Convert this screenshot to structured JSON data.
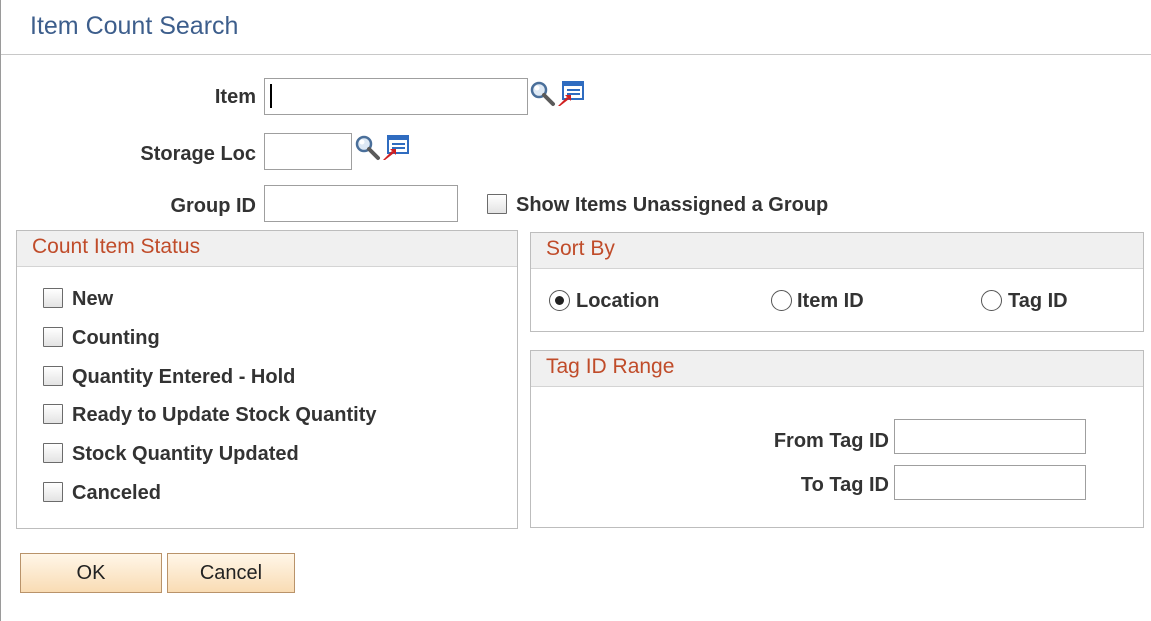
{
  "page": {
    "title": "Item Count Search"
  },
  "fields": {
    "item": {
      "label": "Item",
      "value": ""
    },
    "storage_loc": {
      "label": "Storage Loc",
      "value": ""
    },
    "group_id": {
      "label": "Group ID",
      "value": ""
    },
    "show_unassigned": {
      "label": "Show Items Unassigned a Group",
      "checked": false
    }
  },
  "icons": {
    "lookup": "magnifier-icon",
    "prompt": "list-prompt-icon"
  },
  "count_item_status": {
    "title": "Count Item Status",
    "options": [
      {
        "label": "New",
        "checked": false
      },
      {
        "label": "Counting",
        "checked": false
      },
      {
        "label": "Quantity Entered - Hold",
        "checked": false
      },
      {
        "label": "Ready to Update Stock Quantity",
        "checked": false
      },
      {
        "label": "Stock Quantity Updated",
        "checked": false
      },
      {
        "label": "Canceled",
        "checked": false
      }
    ]
  },
  "sort_by": {
    "title": "Sort By",
    "selected": "Location",
    "options": [
      {
        "label": "Location"
      },
      {
        "label": "Item ID"
      },
      {
        "label": "Tag ID"
      }
    ]
  },
  "tag_id_range": {
    "title": "Tag ID Range",
    "from_label": "From Tag ID",
    "from_value": "",
    "to_label": "To Tag ID",
    "to_value": ""
  },
  "buttons": {
    "ok": "OK",
    "cancel": "Cancel"
  },
  "colors": {
    "title_blue": "#3d5e8c",
    "group_title": "#c04c2a",
    "button_fill": "#f9dcb4"
  }
}
